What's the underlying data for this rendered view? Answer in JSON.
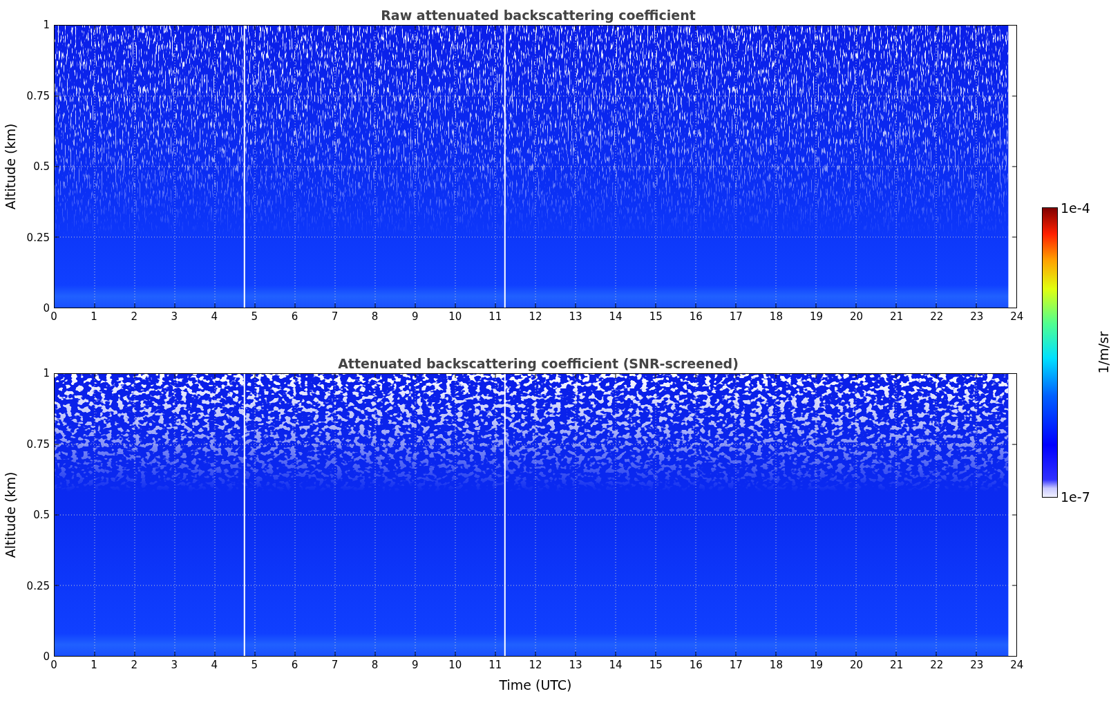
{
  "panels": [
    {
      "kind": "raw",
      "title": "Raw attenuated backscattering coefficient",
      "ylabel": "Altitude (km)",
      "yticks": [
        "1",
        "0.75",
        "0.5",
        "0.25",
        "0"
      ],
      "xticks": [
        "0",
        "1",
        "2",
        "3",
        "4",
        "5",
        "6",
        "7",
        "8",
        "9",
        "10",
        "11",
        "12",
        "13",
        "14",
        "15",
        "16",
        "17",
        "18",
        "19",
        "20",
        "21",
        "22",
        "23",
        "24"
      ]
    },
    {
      "kind": "screened",
      "title": "Attenuated backscattering coefficient (SNR-screened)",
      "ylabel": "Altitude (km)",
      "yticks": [
        "1",
        "0.75",
        "0.5",
        "0.25",
        "0"
      ],
      "xticks": [
        "0",
        "1",
        "2",
        "3",
        "4",
        "5",
        "6",
        "7",
        "8",
        "9",
        "10",
        "11",
        "12",
        "13",
        "14",
        "15",
        "16",
        "17",
        "18",
        "19",
        "20",
        "21",
        "22",
        "23",
        "24"
      ],
      "xlabel": "Time (UTC)"
    }
  ],
  "colorbar": {
    "label": "1/m/sr",
    "max_label": "1e-4",
    "min_label": "1e-7"
  }
}
